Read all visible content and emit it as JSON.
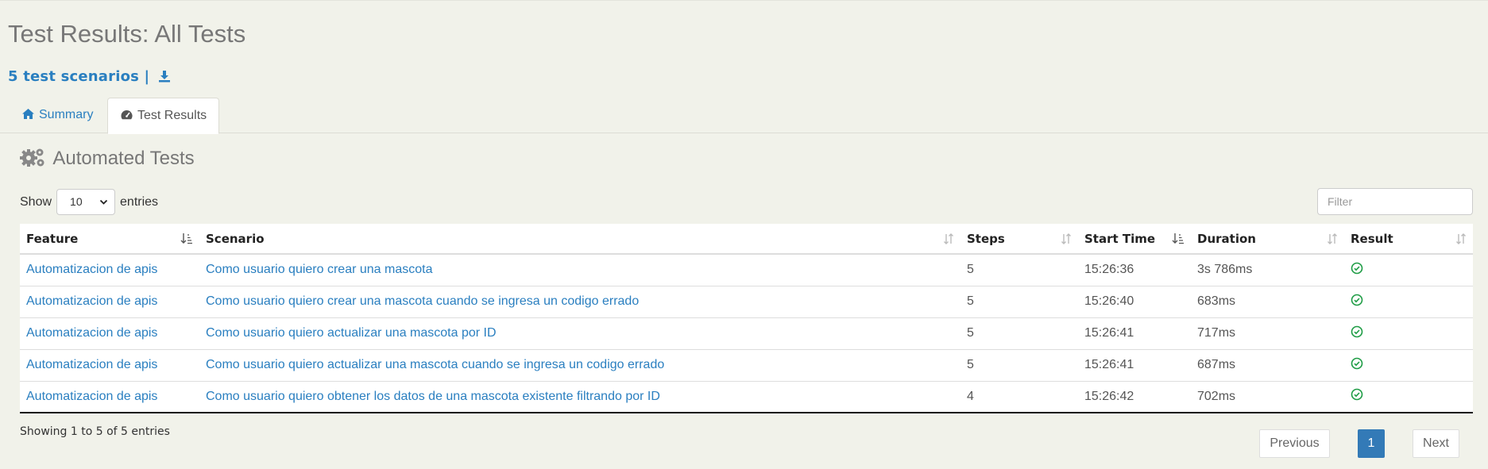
{
  "header": {
    "title": "Test Results: All Tests",
    "scenario_count": "5 test scenarios |"
  },
  "tabs": [
    {
      "label": "Summary",
      "icon": "home-icon",
      "active": false
    },
    {
      "label": "Test Results",
      "icon": "dashboard-icon",
      "active": true
    }
  ],
  "section": {
    "title": "Automated Tests",
    "icon": "cogs-icon"
  },
  "controls": {
    "show_label": "Show",
    "entries_value": "10",
    "entries_label": "entries",
    "filter_placeholder": "Filter"
  },
  "table": {
    "columns": [
      "Feature",
      "Scenario",
      "Steps",
      "Start Time",
      "Duration",
      "Result"
    ],
    "rows": [
      {
        "feature": "Automatizacion de apis",
        "scenario": "Como usuario quiero crear una mascota",
        "steps": "5",
        "start": "15:26:36",
        "duration": "3s 786ms",
        "result": "passed"
      },
      {
        "feature": "Automatizacion de apis",
        "scenario": "Como usuario quiero crear una mascota cuando se ingresa un codigo errado",
        "steps": "5",
        "start": "15:26:40",
        "duration": "683ms",
        "result": "passed"
      },
      {
        "feature": "Automatizacion de apis",
        "scenario": "Como usuario quiero actualizar una mascota por ID",
        "steps": "5",
        "start": "15:26:41",
        "duration": "717ms",
        "result": "passed"
      },
      {
        "feature": "Automatizacion de apis",
        "scenario": "Como usuario quiero actualizar una mascota cuando se ingresa un codigo errado",
        "steps": "5",
        "start": "15:26:41",
        "duration": "687ms",
        "result": "passed"
      },
      {
        "feature": "Automatizacion de apis",
        "scenario": "Como usuario quiero obtener los datos de una mascota existente filtrando por ID",
        "steps": "4",
        "start": "15:26:42",
        "duration": "702ms",
        "result": "passed"
      }
    ]
  },
  "footer": {
    "info": "Showing 1 to 5 of 5 entries",
    "previous": "Previous",
    "page": "1",
    "next": "Next"
  },
  "colors": {
    "background": "#f1f2ea",
    "link": "#2a7fc0",
    "pass": "#1e9c45",
    "active_page": "#337ab7"
  }
}
